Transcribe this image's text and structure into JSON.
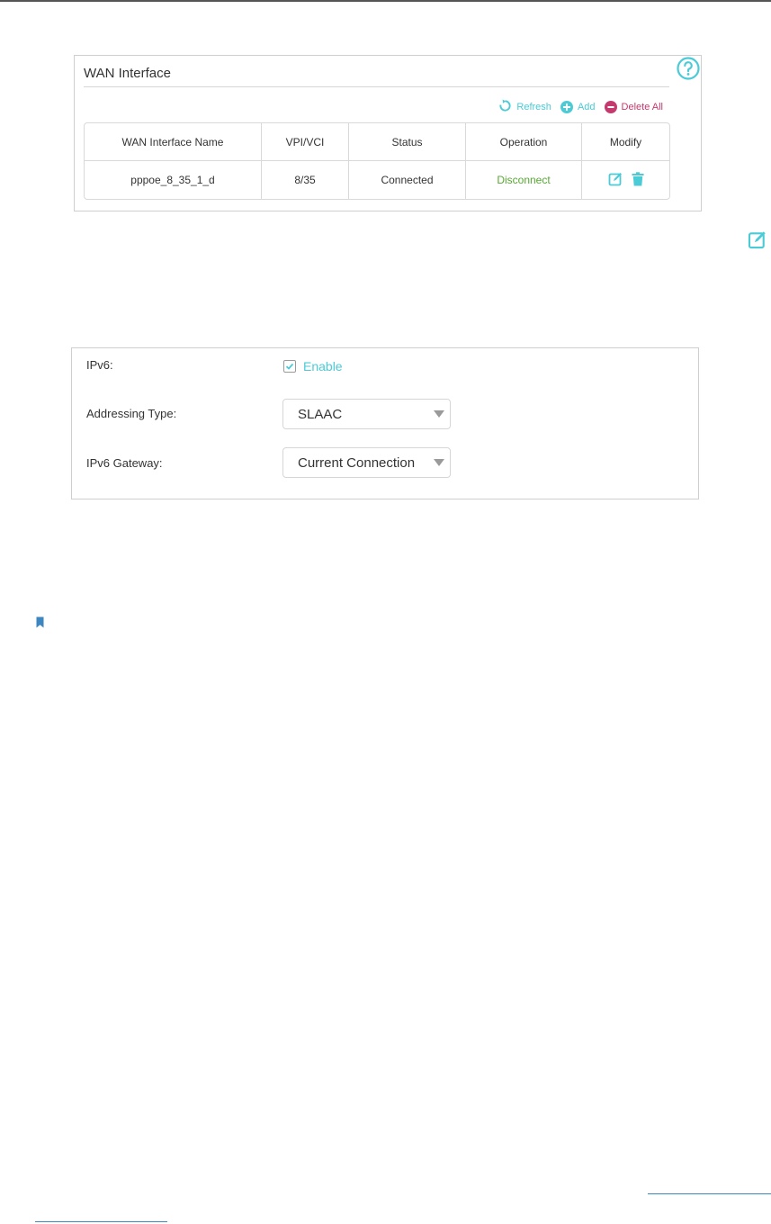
{
  "wan_panel": {
    "title": "WAN Interface",
    "toolbar": {
      "refresh_label": "Refresh",
      "add_label": "Add",
      "delete_all_label": "Delete All"
    },
    "table": {
      "headers": [
        "WAN Interface Name",
        "VPI/VCI",
        "Status",
        "Operation",
        "Modify"
      ],
      "rows": [
        {
          "name": "pppoe_8_35_1_d",
          "vpi_vci": "8/35",
          "status": "Connected",
          "operation": "Disconnect"
        }
      ]
    }
  },
  "ipv6_panel": {
    "ipv6_label": "IPv6:",
    "enable_label": "Enable",
    "enable_checked": true,
    "addressing_type_label": "Addressing Type:",
    "addressing_type_value": "SLAAC",
    "gateway_label": "IPv6 Gateway:",
    "gateway_value": "Current Connection"
  },
  "icons": {
    "help": "help-icon",
    "refresh": "refresh-icon",
    "add": "add-icon",
    "delete_all": "minus-icon",
    "edit": "edit-icon",
    "trash": "trash-icon",
    "bookmark": "bookmark-icon"
  },
  "colors": {
    "accent": "#4acbd6",
    "delete": "#c43a6e",
    "operation": "#57a834",
    "link": "#3e86c0"
  }
}
